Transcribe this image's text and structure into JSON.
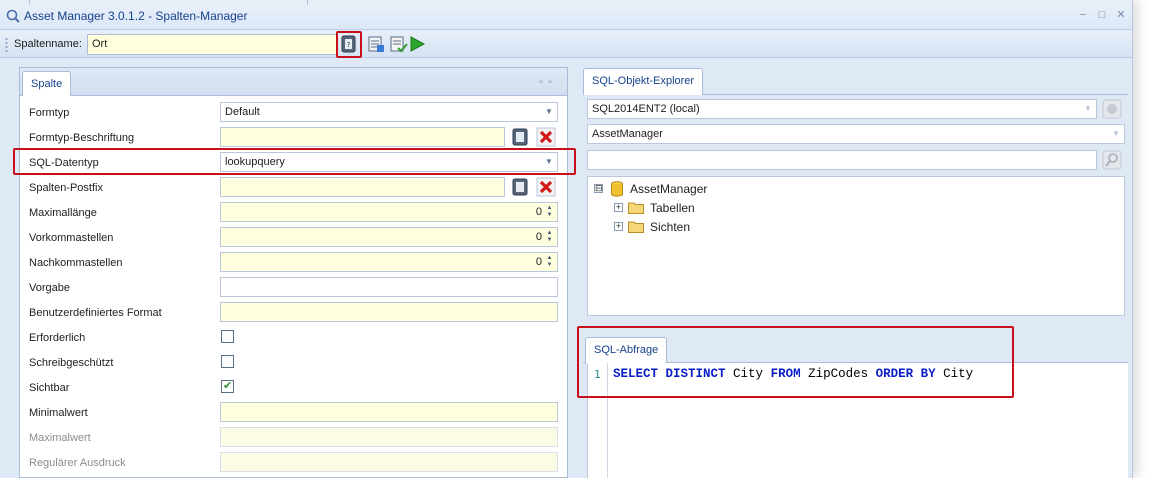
{
  "window": {
    "title": "Asset Manager 3.0.1.2 - Spalten-Manager",
    "buttons": {
      "minimize": "−",
      "maximize": "□",
      "close": "✕"
    }
  },
  "toolbar": {
    "label": "Spaltenname:",
    "value": "Ort",
    "icons": [
      "lookup-icon",
      "script-icon",
      "script-check-icon",
      "run-icon"
    ]
  },
  "column_panel": {
    "tab": "Spalte",
    "rows": [
      {
        "label": "Formtyp",
        "type": "combo",
        "value": "Default"
      },
      {
        "label": "Formtyp-Beschriftung",
        "type": "text-with-buttons",
        "value": ""
      },
      {
        "label": "SQL-Datentyp",
        "type": "combo",
        "value": "lookupquery"
      },
      {
        "label": "Spalten-Postfix",
        "type": "text-with-buttons",
        "value": ""
      },
      {
        "label": "Maximallänge",
        "type": "spin",
        "value": "0"
      },
      {
        "label": "Vorkommastellen",
        "type": "spin",
        "value": "0"
      },
      {
        "label": "Nachkommastellen",
        "type": "spin",
        "value": "0"
      },
      {
        "label": "Vorgabe",
        "type": "text-white",
        "value": ""
      },
      {
        "label": "Benutzerdefiniertes Format",
        "type": "text",
        "value": ""
      },
      {
        "label": "Erforderlich",
        "type": "checkbox",
        "checked": false
      },
      {
        "label": "Schreibgeschützt",
        "type": "checkbox",
        "checked": false
      },
      {
        "label": "Sichtbar",
        "type": "checkbox",
        "checked": true
      },
      {
        "label": "Minimalwert",
        "type": "text",
        "value": ""
      },
      {
        "label": "Maximalwert",
        "type": "text-dim",
        "value": ""
      },
      {
        "label": "Regulärer Ausdruck",
        "type": "text-dim",
        "value": ""
      }
    ]
  },
  "explorer": {
    "tab": "SQL-Objekt-Explorer",
    "server": "SQL2014ENT2 (local)",
    "database": "AssetManager",
    "filter": "",
    "tree": [
      {
        "label": "AssetManager",
        "icon": "database-icon",
        "expander": "⊟"
      },
      {
        "label": "Tabellen",
        "icon": "folder-icon",
        "expander": "+"
      },
      {
        "label": "Sichten",
        "icon": "folder-icon",
        "expander": "+"
      }
    ]
  },
  "sql_query": {
    "tab": "SQL-Abfrage",
    "line_number": "1",
    "tokens": [
      {
        "text": "SELECT",
        "kw": true
      },
      {
        "text": " ",
        "kw": false
      },
      {
        "text": "DISTINCT",
        "kw": true
      },
      {
        "text": " City ",
        "kw": false
      },
      {
        "text": "FROM",
        "kw": true
      },
      {
        "text": " ZipCodes ",
        "kw": false
      },
      {
        "text": "ORDER",
        "kw": true
      },
      {
        "text": " ",
        "kw": false
      },
      {
        "text": "BY",
        "kw": true
      },
      {
        "text": " City",
        "kw": false
      }
    ]
  },
  "colors": {
    "field_bg": "#ffffe0",
    "highlight_border": "#c8101a",
    "keyword": "#0a1ec8",
    "title_text": "#15428b"
  }
}
